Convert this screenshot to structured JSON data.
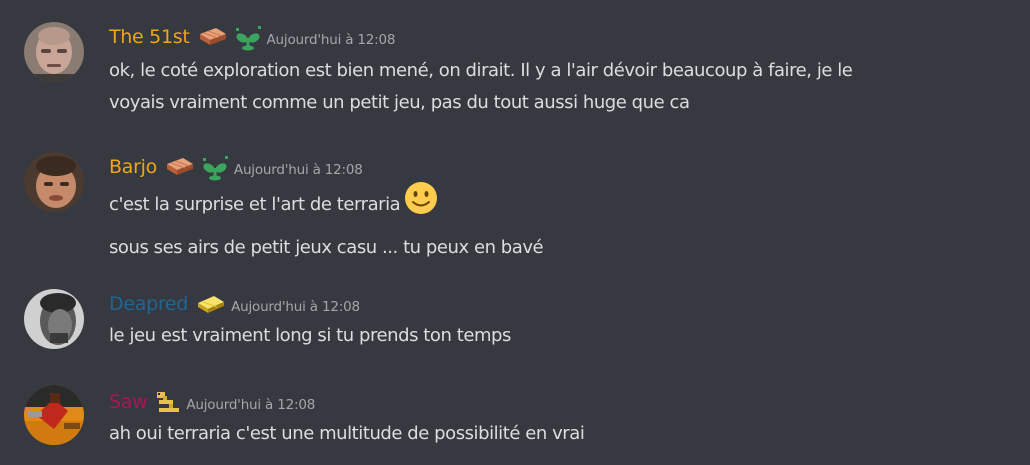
{
  "messages": [
    {
      "username": "The 51st",
      "username_color": "#f0a516",
      "badges": [
        "brick-icon",
        "sprout-icon"
      ],
      "timestamp": "Aujourd'hui à 12:08",
      "lines": [
        "ok, le coté exploration est bien mené, on dirait. Il y a l'air dévoir beaucoup à faire, je le",
        "voyais vraiment comme un petit jeu, pas du tout aussi huge que ca"
      ]
    },
    {
      "username": "Barjo",
      "username_color": "#f0a516",
      "badges": [
        "brick-icon",
        "sprout-icon"
      ],
      "timestamp": "Aujourd'hui à 12:08",
      "lines": [
        "c'est la surprise et l'art de terraria",
        "sous ses airs de petit jeux casu ... tu peux en bavé"
      ],
      "emoji": "slightly-smiling-face-icon"
    },
    {
      "username": "Deapred",
      "username_color": "#206694",
      "badges": [
        "gold-bar-icon"
      ],
      "timestamp": "Aujourd'hui à 12:08",
      "lines": [
        "le jeu est vraiment long si tu prends ton temps"
      ]
    },
    {
      "username": "Saw",
      "username_color": "#ad1457",
      "badges": [
        "snake-icon"
      ],
      "timestamp": "Aujourd'hui à 12:08",
      "lines": [
        "ah oui terraria c'est une multitude de possibilité en vrai"
      ]
    }
  ],
  "colors": {
    "background": "#36393f",
    "text": "#dcddde",
    "timestamp": "#a3a6aa"
  }
}
